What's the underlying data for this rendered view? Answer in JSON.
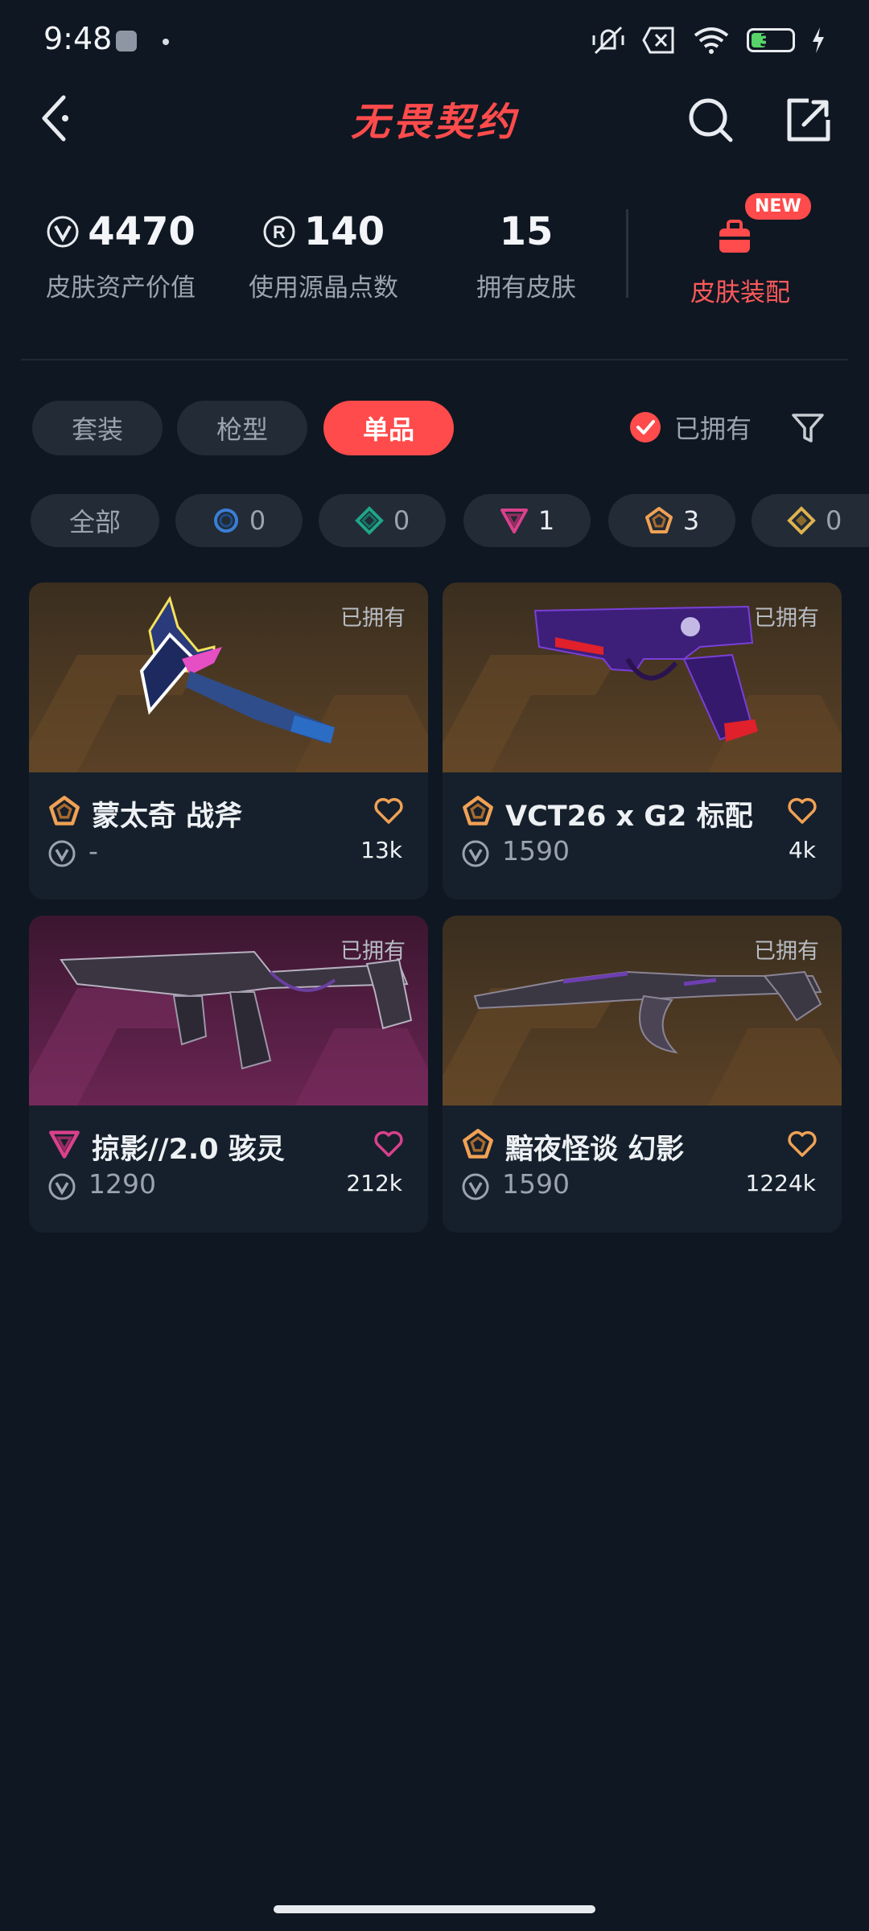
{
  "status": {
    "time": "9:48",
    "battery": "34"
  },
  "header": {
    "title": "无畏契约"
  },
  "stats": [
    {
      "value": "4470",
      "label": "皮肤资产价值",
      "icon": "vp-icon"
    },
    {
      "value": "140",
      "label": "使用源晶点数",
      "icon": "radianite-icon"
    },
    {
      "value": "15",
      "label": "拥有皮肤"
    }
  ],
  "loadout": {
    "label": "皮肤装配",
    "badge": "NEW"
  },
  "tabs": [
    {
      "label": "套装",
      "active": false
    },
    {
      "label": "枪型",
      "active": false
    },
    {
      "label": "单品",
      "active": true
    }
  ],
  "owned_filter": {
    "label": "已拥有",
    "checked": true
  },
  "rarity_chips": [
    {
      "label": "全部"
    },
    {
      "count": "0",
      "tier": "select",
      "color": "#3a7ed6"
    },
    {
      "count": "0",
      "tier": "deluxe",
      "color": "#1fa68a"
    },
    {
      "count": "1",
      "tier": "premium",
      "color": "#d9418c"
    },
    {
      "count": "3",
      "tier": "exclusive",
      "color": "#f0a155"
    },
    {
      "count": "0",
      "tier": "ultra",
      "color": "#e0b24e"
    }
  ],
  "items": [
    {
      "name": "蒙太奇 战斧",
      "price": "-",
      "likes": "13k",
      "owned": "已拥有",
      "tier_color": "#f0a155",
      "heart_color": "#f0a155",
      "bg": "gold"
    },
    {
      "name": "VCT26 x G2 标配",
      "price": "1590",
      "likes": "4k",
      "owned": "已拥有",
      "tier_color": "#f0a155",
      "heart_color": "#f0a155",
      "bg": "gold"
    },
    {
      "name": "掠影//2.0 骇灵",
      "price": "1290",
      "likes": "212k",
      "owned": "已拥有",
      "tier_color": "#d9418c",
      "heart_color": "#d9418c",
      "bg": "pink"
    },
    {
      "name": "黯夜怪谈 幻影",
      "price": "1590",
      "likes": "1224k",
      "owned": "已拥有",
      "tier_color": "#f0a155",
      "heart_color": "#f0a155",
      "bg": "gold"
    }
  ]
}
